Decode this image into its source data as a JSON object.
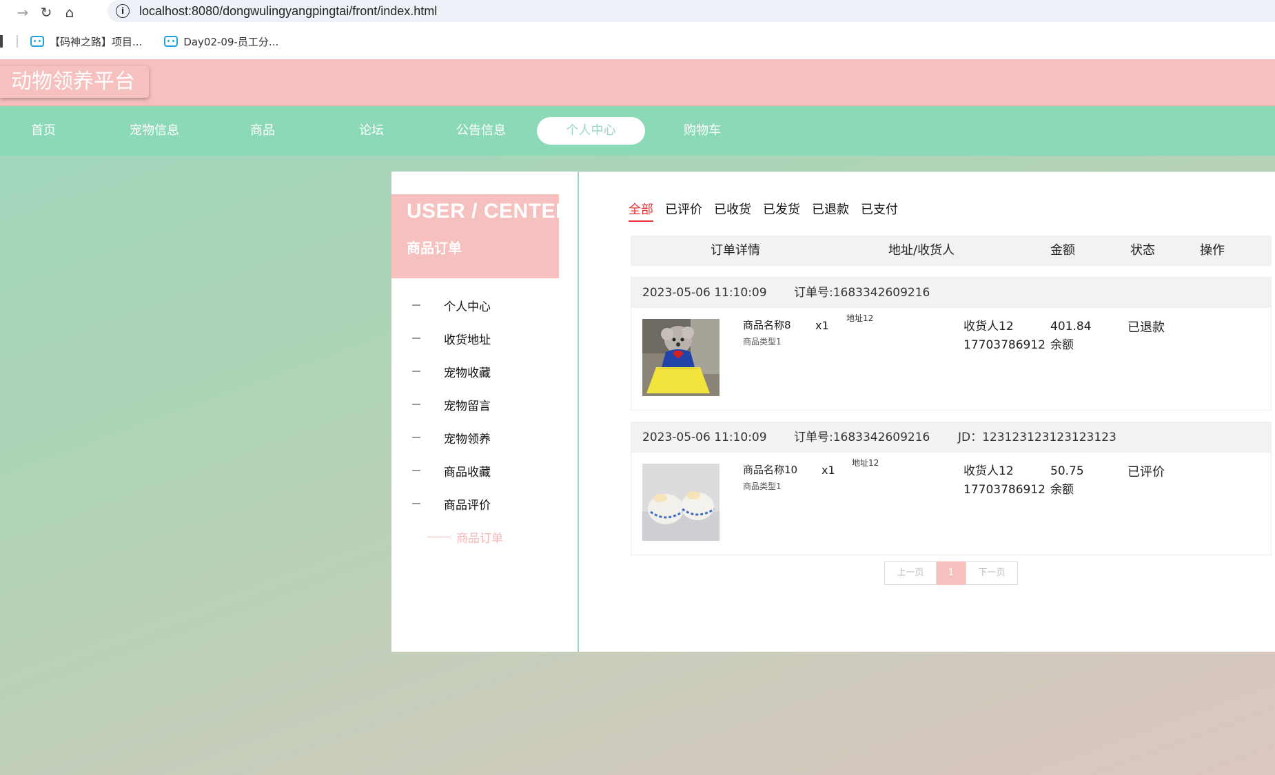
{
  "browser": {
    "url": "localhost:8080/dongwulingyangpingtai/front/index.html",
    "bookmarks": [
      {
        "label": "【码神之路】项目..."
      },
      {
        "label": "Day02-09-员工分..."
      }
    ]
  },
  "site": {
    "logo": "动物领养平台",
    "nav": [
      {
        "label": "首页"
      },
      {
        "label": "宠物信息"
      },
      {
        "label": "商品"
      },
      {
        "label": "论坛"
      },
      {
        "label": "公告信息"
      },
      {
        "label": "个人中心",
        "active": true
      },
      {
        "label": "购物车"
      }
    ]
  },
  "sidebar": {
    "title": "USER / CENTER",
    "subtitle": "商品订单",
    "items": [
      {
        "label": "个人中心"
      },
      {
        "label": "收货地址"
      },
      {
        "label": "宠物收藏"
      },
      {
        "label": "宠物留言"
      },
      {
        "label": "宠物领养"
      },
      {
        "label": "商品收藏"
      },
      {
        "label": "商品评价"
      },
      {
        "label": "商品订单",
        "active": true
      }
    ]
  },
  "orders_page": {
    "tabs": [
      {
        "label": "全部",
        "active": true
      },
      {
        "label": "已评价"
      },
      {
        "label": "已收货"
      },
      {
        "label": "已发货"
      },
      {
        "label": "已退款"
      },
      {
        "label": "已支付"
      }
    ],
    "columns": [
      "订单详情",
      "地址/收货人",
      "金额",
      "状态",
      "操作"
    ],
    "orders": [
      {
        "date": "2023-05-06 11:10:09",
        "order_no": "订单号:1683342609216",
        "jd": "",
        "product_name": "商品名称8",
        "product_type": "商品类型1",
        "qty": "x1",
        "address": "地址12",
        "receiver": "收货人12",
        "phone": "17703786912",
        "amount": "401.84",
        "pay_method": "余额",
        "status": "已退款"
      },
      {
        "date": "2023-05-06 11:10:09",
        "order_no": "订单号:1683342609216",
        "jd": "JD：123123123123123123",
        "product_name": "商品名称10",
        "product_type": "商品类型1",
        "qty": "x1",
        "address": "地址12",
        "receiver": "收货人12",
        "phone": "17703786912",
        "amount": "50.75",
        "pay_method": "余额",
        "status": "已评价"
      }
    ],
    "pager": {
      "prev": "上一页",
      "current": "1",
      "next": "下一页"
    }
  },
  "colors": {
    "accent_pink": "#f6c0bf",
    "nav_green": "#8cd9b7",
    "tab_active": "#e53333"
  }
}
